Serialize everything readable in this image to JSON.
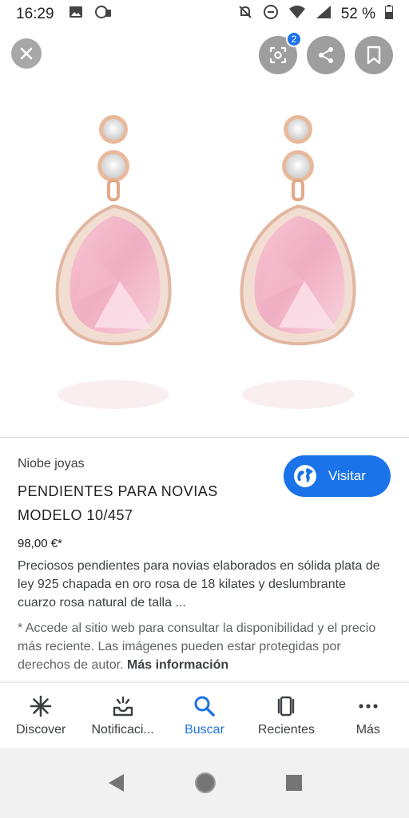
{
  "status_bar": {
    "time": "16:29",
    "battery": "52 %",
    "icons": [
      "image-icon",
      "whatsapp-icon",
      "mute-icon",
      "dnd-icon",
      "wifi-icon",
      "signal-icon",
      "battery-icon"
    ]
  },
  "image_viewer": {
    "close_icon": "close-icon",
    "lens_badge": "2",
    "share_icon": "share-icon",
    "save_icon": "bookmark-icon",
    "image_subject": "pink-quartz-drop-earrings"
  },
  "product": {
    "source": "Niobe joyas",
    "title": "PENDIENTES PARA NOVIAS MODELO 10/457",
    "price": "98,00 €*",
    "description": "Preciosos pendientes para novias elaborados en sólida plata de ley 925 chapada en oro rosa de 18 kilates y deslumbrante cuarzo rosa natural de talla ...",
    "notice": "* Accede al sitio web para consultar la disponibilidad y el precio más reciente. Las imágenes pueden estar protegidas por derechos de autor.",
    "more_info": "Más información",
    "visit_label": "Visitar"
  },
  "bottom_nav": {
    "items": [
      {
        "label": "Discover",
        "icon": "discover-icon"
      },
      {
        "label": "Notificaci...",
        "icon": "notifications-icon"
      },
      {
        "label": "Buscar",
        "icon": "search-icon"
      },
      {
        "label": "Recientes",
        "icon": "recents-icon"
      },
      {
        "label": "Más",
        "icon": "more-icon"
      }
    ],
    "active_index": 2
  },
  "colors": {
    "accent": "#1a73e8",
    "text": "#202124",
    "muted": "#5f6368"
  }
}
